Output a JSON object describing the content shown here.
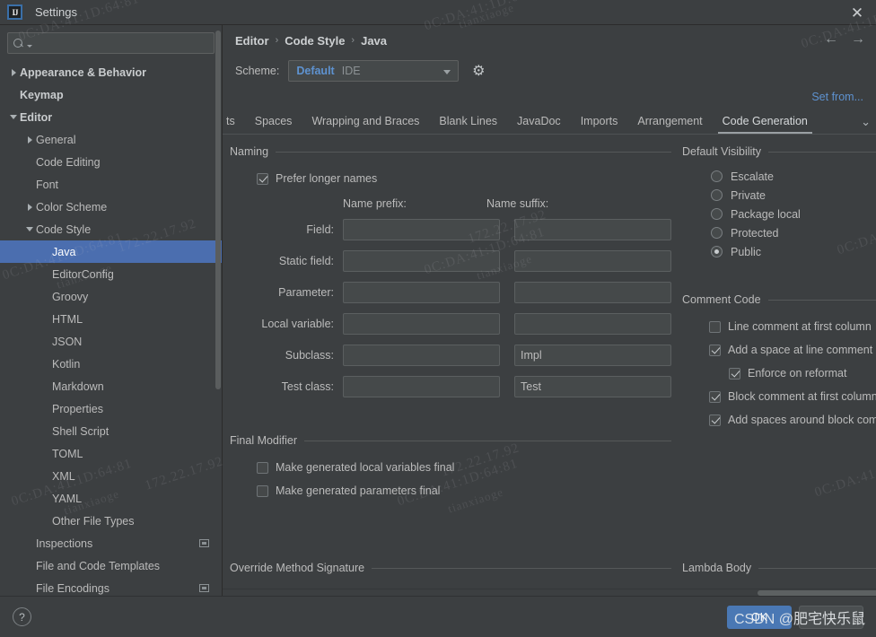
{
  "window": {
    "title": "Settings",
    "logo_text": "IJ",
    "close_icon": "✕"
  },
  "sidebar": {
    "search": {
      "placeholder": "",
      "value": ""
    },
    "items": [
      {
        "label": "Appearance & Behavior",
        "indent": 0,
        "arrow": "collapsed",
        "bold": true,
        "selected": false,
        "badge": false
      },
      {
        "label": "Keymap",
        "indent": 0,
        "arrow": "none",
        "bold": true,
        "selected": false,
        "badge": false
      },
      {
        "label": "Editor",
        "indent": 0,
        "arrow": "expanded",
        "bold": true,
        "selected": false,
        "badge": false
      },
      {
        "label": "General",
        "indent": 1,
        "arrow": "collapsed",
        "bold": false,
        "selected": false,
        "badge": false
      },
      {
        "label": "Code Editing",
        "indent": 1,
        "arrow": "none",
        "bold": false,
        "selected": false,
        "badge": false
      },
      {
        "label": "Font",
        "indent": 1,
        "arrow": "none",
        "bold": false,
        "selected": false,
        "badge": false
      },
      {
        "label": "Color Scheme",
        "indent": 1,
        "arrow": "collapsed",
        "bold": false,
        "selected": false,
        "badge": false
      },
      {
        "label": "Code Style",
        "indent": 1,
        "arrow": "expanded",
        "bold": false,
        "selected": false,
        "badge": false
      },
      {
        "label": "Java",
        "indent": 2,
        "arrow": "none",
        "bold": false,
        "selected": true,
        "badge": false
      },
      {
        "label": "EditorConfig",
        "indent": 2,
        "arrow": "none",
        "bold": false,
        "selected": false,
        "badge": false
      },
      {
        "label": "Groovy",
        "indent": 2,
        "arrow": "none",
        "bold": false,
        "selected": false,
        "badge": false
      },
      {
        "label": "HTML",
        "indent": 2,
        "arrow": "none",
        "bold": false,
        "selected": false,
        "badge": false
      },
      {
        "label": "JSON",
        "indent": 2,
        "arrow": "none",
        "bold": false,
        "selected": false,
        "badge": false
      },
      {
        "label": "Kotlin",
        "indent": 2,
        "arrow": "none",
        "bold": false,
        "selected": false,
        "badge": false
      },
      {
        "label": "Markdown",
        "indent": 2,
        "arrow": "none",
        "bold": false,
        "selected": false,
        "badge": false
      },
      {
        "label": "Properties",
        "indent": 2,
        "arrow": "none",
        "bold": false,
        "selected": false,
        "badge": false
      },
      {
        "label": "Shell Script",
        "indent": 2,
        "arrow": "none",
        "bold": false,
        "selected": false,
        "badge": false
      },
      {
        "label": "TOML",
        "indent": 2,
        "arrow": "none",
        "bold": false,
        "selected": false,
        "badge": false
      },
      {
        "label": "XML",
        "indent": 2,
        "arrow": "none",
        "bold": false,
        "selected": false,
        "badge": false
      },
      {
        "label": "YAML",
        "indent": 2,
        "arrow": "none",
        "bold": false,
        "selected": false,
        "badge": false
      },
      {
        "label": "Other File Types",
        "indent": 2,
        "arrow": "none",
        "bold": false,
        "selected": false,
        "badge": false
      },
      {
        "label": "Inspections",
        "indent": 1,
        "arrow": "none",
        "bold": false,
        "selected": false,
        "badge": true
      },
      {
        "label": "File and Code Templates",
        "indent": 1,
        "arrow": "none",
        "bold": false,
        "selected": false,
        "badge": false
      },
      {
        "label": "File Encodings",
        "indent": 1,
        "arrow": "none",
        "bold": false,
        "selected": false,
        "badge": true
      }
    ]
  },
  "main": {
    "breadcrumb": [
      "Editor",
      "Code Style",
      "Java"
    ],
    "breadcrumb_separator": "›",
    "nav_back_icon": "←",
    "nav_forward_icon": "→",
    "scheme_label": "Scheme:",
    "scheme_name": "Default",
    "scheme_scope": "IDE",
    "gear_icon": "⚙",
    "set_from_label": "Set from...",
    "tabs": [
      {
        "label": "ts",
        "clipped": true,
        "active": false
      },
      {
        "label": "Spaces",
        "clipped": false,
        "active": false
      },
      {
        "label": "Wrapping and Braces",
        "clipped": false,
        "active": false
      },
      {
        "label": "Blank Lines",
        "clipped": false,
        "active": false
      },
      {
        "label": "JavaDoc",
        "clipped": false,
        "active": false
      },
      {
        "label": "Imports",
        "clipped": false,
        "active": false
      },
      {
        "label": "Arrangement",
        "clipped": false,
        "active": false
      },
      {
        "label": "Code Generation",
        "clipped": false,
        "active": true
      }
    ],
    "tab_overflow_icon": "⌄"
  },
  "naming": {
    "group_title": "Naming",
    "prefer_longer_names": {
      "label": "Prefer longer names",
      "checked": true
    },
    "col_prefix_header": "Name prefix:",
    "col_suffix_header": "Name suffix:",
    "rows": [
      {
        "label": "Field:",
        "prefix": "",
        "suffix": ""
      },
      {
        "label": "Static field:",
        "prefix": "",
        "suffix": ""
      },
      {
        "label": "Parameter:",
        "prefix": "",
        "suffix": ""
      },
      {
        "label": "Local variable:",
        "prefix": "",
        "suffix": ""
      },
      {
        "label": "Subclass:",
        "prefix": "",
        "suffix": "Impl"
      },
      {
        "label": "Test class:",
        "prefix": "",
        "suffix": "Test"
      }
    ]
  },
  "default_visibility": {
    "group_title": "Default Visibility",
    "options": [
      {
        "label": "Escalate",
        "selected": false
      },
      {
        "label": "Private",
        "selected": false
      },
      {
        "label": "Package local",
        "selected": false
      },
      {
        "label": "Protected",
        "selected": false
      },
      {
        "label": "Public",
        "selected": true
      }
    ]
  },
  "final_modifier": {
    "group_title": "Final Modifier",
    "items": [
      {
        "label": "Make generated local variables final",
        "checked": false,
        "indent": false
      },
      {
        "label": "Make generated parameters final",
        "checked": false,
        "indent": false
      }
    ]
  },
  "comment_code": {
    "group_title": "Comment Code",
    "highlight_color": "#e8262b",
    "items": [
      {
        "label": "Line comment at first column",
        "checked": false,
        "indent": false
      },
      {
        "label": "Add a space at line comment start",
        "checked": true,
        "indent": false
      },
      {
        "label": "Enforce on reformat",
        "checked": true,
        "indent": true
      },
      {
        "label": "Block comment at first column",
        "checked": true,
        "indent": false
      },
      {
        "label": "Add spaces around block comments",
        "checked": true,
        "indent": false
      }
    ]
  },
  "override_method_signature": {
    "group_title": "Override Method Signature"
  },
  "lambda_body": {
    "group_title": "Lambda Body"
  },
  "footer": {
    "help_label": "?",
    "ok_label": "OK"
  },
  "watermarks": {
    "ip": "172.22.17.92",
    "mac": "0C:DA:41:1D:64:81",
    "user": "tianxiaoge",
    "csdn": "CSDN @肥宅快乐鼠"
  },
  "colors": {
    "background": "#3c3f41",
    "selection": "#4b6eaf",
    "accent_link": "#5e92d0",
    "highlight_red": "#e8262b",
    "ok_button": "#4a78b4"
  }
}
